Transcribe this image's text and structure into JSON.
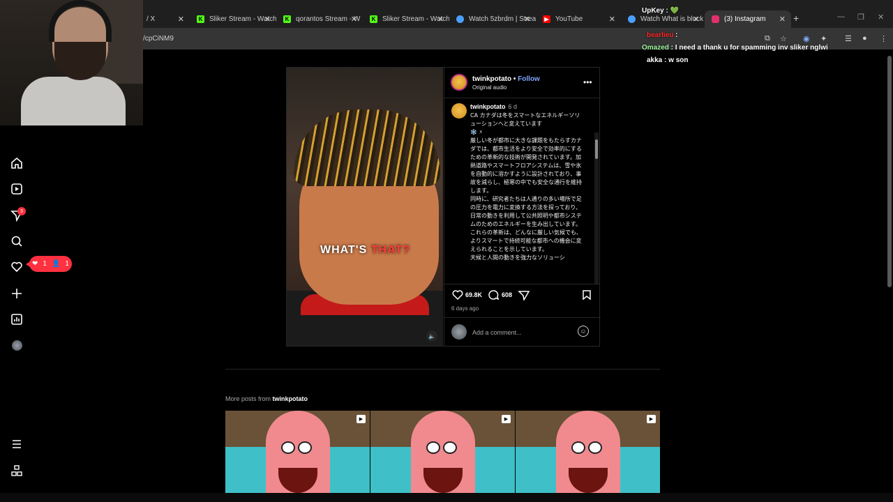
{
  "browser": {
    "tabs": [
      {
        "label": "/ X",
        "icon": "x-icon"
      },
      {
        "label": "Sliker Stream - Watch",
        "icon": "kick-icon",
        "color": "#53fc18"
      },
      {
        "label": "qorantos Stream - W",
        "icon": "kick-icon",
        "color": "#53fc18"
      },
      {
        "label": "Sliker Stream - Watch",
        "icon": "kick-icon",
        "color": "#53fc18"
      },
      {
        "label": "Watch 5zbrdm | Strea",
        "icon": "globe-icon",
        "color": "#4a9eff"
      },
      {
        "label": "YouTube",
        "icon": "youtube-icon",
        "color": "#ff0000"
      },
      {
        "label": "Watch What is bluck",
        "icon": "globe-icon",
        "color": "#4a9eff"
      },
      {
        "label": "(3) Instagram",
        "icon": "instagram-icon",
        "color": "#e1306c"
      }
    ],
    "url": "/cpCiNM9"
  },
  "sidebar": {
    "notification_badge": "3",
    "notif_likes": "1",
    "notif_follows": "1"
  },
  "chat": [
    {
      "user": "UpKey",
      "message": " : 💚",
      "color": "#ffffff"
    },
    {
      "user": "bearlieu",
      "message": " : ",
      "color": "#ff2a2a"
    },
    {
      "user": "Omazed",
      "message": " : I need a thank u for spamming inv sliker nglwi",
      "color": "#9ff59f"
    },
    {
      "user": "akka",
      "message": " : w son",
      "color": "#ffffff"
    }
  ],
  "post": {
    "username": "twinkpotato",
    "follow": "Follow",
    "audio": "Original audio",
    "caption_text": "WHAT'S",
    "caption_highlight": "THAT?",
    "comment": {
      "username": "twinkpotato",
      "time": "6 d",
      "body": "CA カナダは冬をスマートなエネルギーソリューションへと変えています\n❄️ ⚡\n厳しい冬が都市に大きな課題をもたらすカナダでは、都市生活をより安全で効率的にするための革新的な技術が開発されています。加熱道路やスマートフロアシステムは、雪や氷を自動的に溶かすように設計されており、事故を減らし、極寒の中でも安全な通行を維持します。\n同時に、研究者たちは人通りの多い場所で足の圧力を電力に変換する方法を探っており、日常の動きを利用して公共照明や都市システムのためのエネルギーを生み出しています。\nこれらの革新は、どんなに厳しい気候でも、よりスマートで持続可能な都市への機会に変えられることを示しています。\n天候と人間の動きを強力なソリューシ"
    },
    "likes": "69.8K",
    "comments": "608",
    "posted": "6 days ago",
    "add_comment_placeholder": "Add a comment..."
  },
  "more_posts": {
    "prefix": "More posts from ",
    "username": "twinkpotato"
  }
}
